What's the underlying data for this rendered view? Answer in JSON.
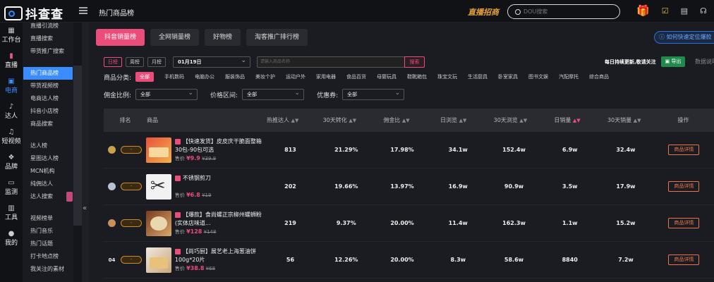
{
  "app": {
    "logo_text": "抖查查",
    "page_title": "热门商品榜",
    "live_merch": "直播招商",
    "search_placeholder": "DOU搜索",
    "colors": {
      "accent": "#ea4d7a",
      "primary": "#3a8dff",
      "export": "#1f8a4c"
    }
  },
  "sidebar": {
    "items": [
      {
        "icon": "grid-icon",
        "label": "工作台"
      },
      {
        "icon": "bar-chart-icon",
        "label": "直播"
      },
      {
        "icon": "bag-icon",
        "label": "电商"
      },
      {
        "icon": "person-icon",
        "label": "达人"
      },
      {
        "icon": "tiktok-icon",
        "label": "短视频"
      },
      {
        "icon": "brand-icon",
        "label": "品牌"
      },
      {
        "icon": "monitor-icon",
        "label": "监测"
      },
      {
        "icon": "toolbox-icon",
        "label": "工具"
      },
      {
        "icon": "user-icon",
        "label": "我的"
      }
    ]
  },
  "subnav": {
    "group1": [
      "直播引流榜",
      "直播搜索",
      "带货推广搜索"
    ],
    "group2": [
      "热门商品榜",
      "带货视频榜",
      "电商达人榜",
      "抖音小店榜",
      "商品搜索"
    ],
    "group3": [
      "达人榜",
      "星图达人榜",
      "MCN机构",
      "纯佣达人",
      "达人搜索"
    ],
    "group4": [
      "视频榜单",
      "热门音乐",
      "热门话题",
      "打卡地点榜",
      "我关注的素材"
    ]
  },
  "tabs": [
    "抖音销量榜",
    "全网销量榜",
    "好物榜",
    "淘客推广排行榜"
  ],
  "help_link": "如何快速定位爆款",
  "period_buttons": [
    "日榜",
    "周榜",
    "月榜"
  ],
  "date_value": "01月19日",
  "product_search_placeholder": "请输入商品名称",
  "search_button": "搜索",
  "update_note": "每日持续更新,敬请关注",
  "export_label": "导出",
  "data_desc": "数据说明",
  "category_label": "商品分类:",
  "categories": [
    "全部",
    "手机数码",
    "电脑办公",
    "服装饰品",
    "美妆个护",
    "运动户外",
    "家用电器",
    "食品百货",
    "母婴玩具",
    "鞋靴箱包",
    "珠宝文玩",
    "生活厨具",
    "卧室家具",
    "图书文娱",
    "汽配摩托",
    "综合商品"
  ],
  "filters": [
    {
      "label": "佣金比例:",
      "value": "全部"
    },
    {
      "label": "价格区间:",
      "value": "全部"
    },
    {
      "label": "优惠券:",
      "value": "全部"
    }
  ],
  "table": {
    "headers": [
      "排名",
      "商品",
      "热推达人",
      "30天转化",
      "佣金比",
      "日浏览",
      "30天浏览",
      "日销量",
      "30天销量",
      "操作"
    ],
    "pill": "-",
    "detail_label": "商品详情",
    "price_label": "售价",
    "rows": [
      {
        "rank": "",
        "medal": "gold-medal-icon",
        "name": "【快速发货】皮皮庆干脆面整箱30包-90包可选",
        "price": "¥9.9",
        "old_price": "¥39.9",
        "cells": [
          "813",
          "21.29%",
          "17.98%",
          "34.1w",
          "152.4w",
          "6.9w",
          "32.4w"
        ]
      },
      {
        "rank": "",
        "medal": "silver-medal-icon",
        "name": "不锈钢剪刀",
        "price": "¥6.8",
        "old_price": "¥19",
        "cells": [
          "202",
          "19.66%",
          "13.97%",
          "16.9w",
          "90.9w",
          "3.5w",
          "17.9w"
        ]
      },
      {
        "rank": "",
        "medal": "bronze-medal-icon",
        "name": "【爆款】食尚螺正宗柳州螺蛳粉(实体店味道...",
        "price": "¥128",
        "old_price": "¥148",
        "cells": [
          "219",
          "9.37%",
          "20.00%",
          "11.4w",
          "162.3w",
          "1.1w",
          "15.2w"
        ]
      },
      {
        "rank": "04",
        "medal": "",
        "name": "【尚巧厨】展艺老上海葱油饼 100g*20片",
        "price": "¥38.8",
        "old_price": "¥68",
        "cells": [
          "56",
          "12.26%",
          "20.00%",
          "8.3w",
          "58.6w",
          "8840",
          "7.2w"
        ]
      }
    ]
  }
}
